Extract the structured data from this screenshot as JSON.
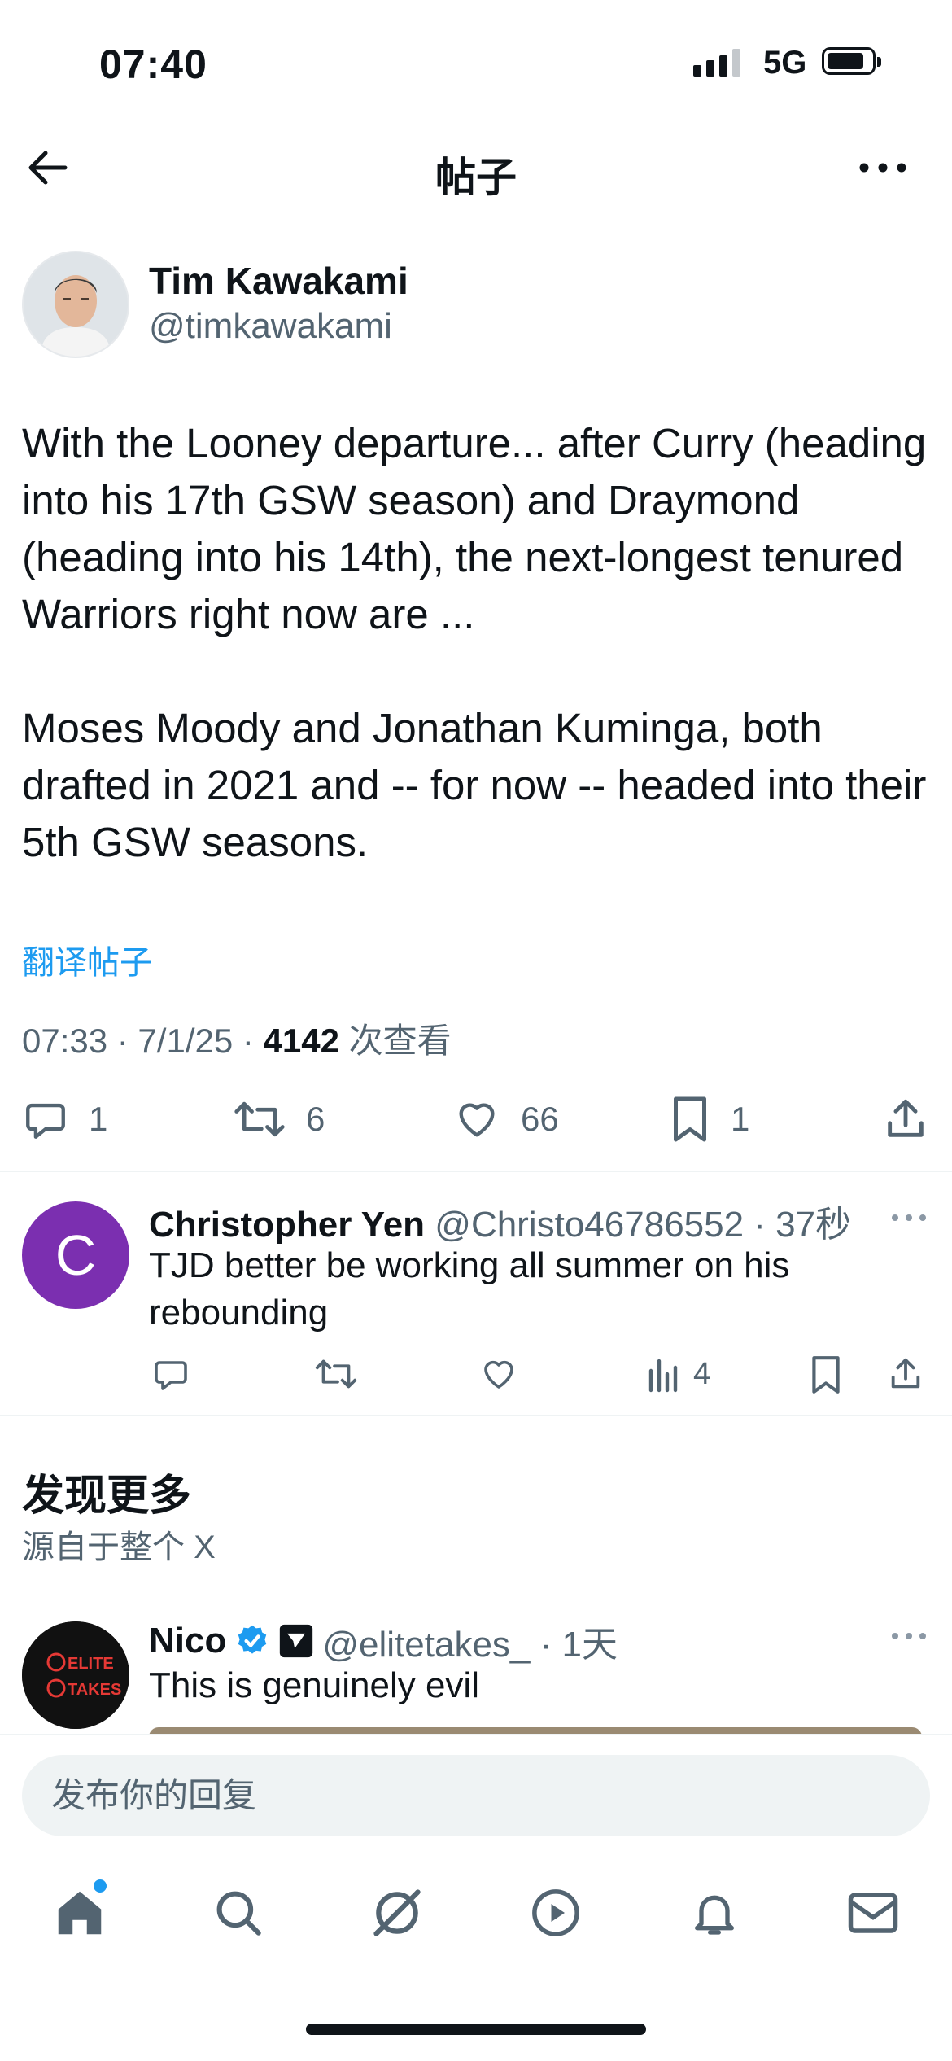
{
  "status_bar": {
    "time": "07:40",
    "network": "5G"
  },
  "header": {
    "title": "帖子"
  },
  "tweet": {
    "author_name": "Tim Kawakami",
    "author_handle": "@timkawakami",
    "text": "With the Looney departure... after Curry (heading into his 17th GSW season) and Draymond (heading into his 14th), the next-longest tenured Warriors right now are ...\n\nMoses Moody and Jonathan Kuminga, both drafted in 2021 and -- for now -- headed into their 5th GSW seasons.",
    "translate_label": "翻译帖子",
    "timestamp": "07:33 · 7/1/25 · ",
    "views_count": "4142",
    "views_label": " 次查看",
    "replies": "1",
    "reposts": "6",
    "likes": "66",
    "bookmarks": "1"
  },
  "reply": {
    "avatar_letter": "C",
    "name": "Christopher Yen",
    "meta": " @Christo46786552 · 37秒",
    "text": "TJD better be working all summer on his rebounding",
    "views": "4"
  },
  "discover": {
    "title": "发现更多",
    "subtitle": "源自于整个 X"
  },
  "suggested": {
    "name": "Nico",
    "meta": "@elitetakes_ · 1天",
    "text": "This is genuinely evil",
    "avatar_logo_line1": "ELITE",
    "avatar_logo_line2": "TAKES"
  },
  "composer": {
    "placeholder": "发布你的回复"
  },
  "colors": {
    "accent": "#1d9bf0",
    "text": "#0f1419",
    "secondary": "#536471",
    "reply_avatar": "#7b2fb0"
  }
}
